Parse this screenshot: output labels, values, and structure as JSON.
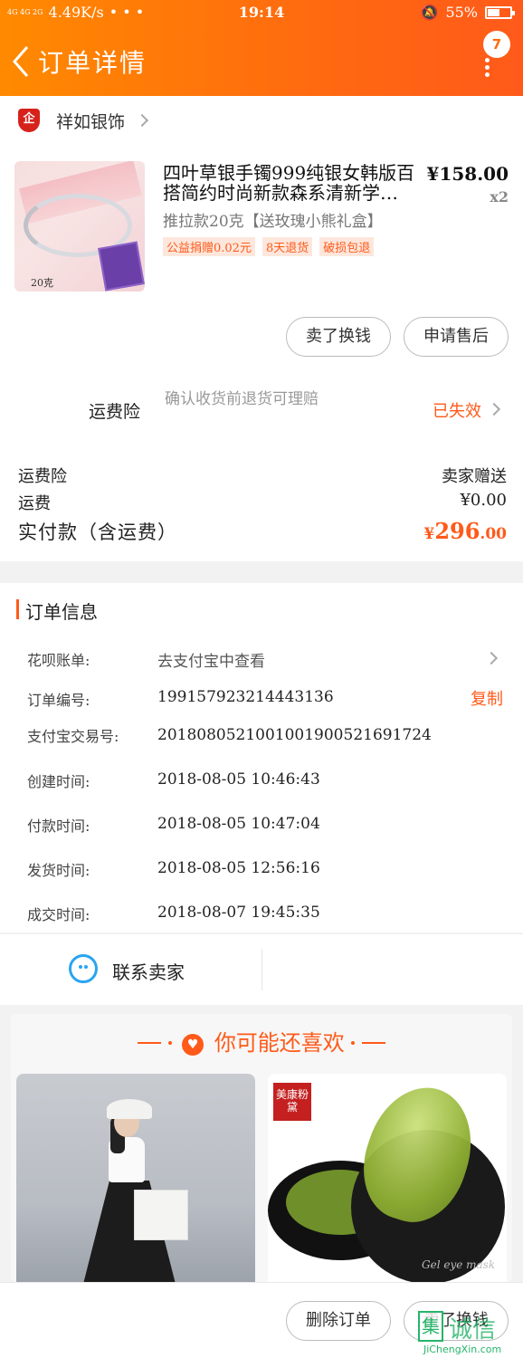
{
  "status_bar": {
    "signal": "4G 4G 2G",
    "speed": "4.49K/s",
    "dots": "• • •",
    "time": "19:14",
    "battery": "55%",
    "battery_level": 0.55
  },
  "nav": {
    "title": "订单详情",
    "badge_count": "7"
  },
  "store": {
    "logo_text": "企",
    "name": "祥如银饰"
  },
  "product": {
    "image_caption": "20克",
    "title": "四叶草银手镯999纯银女韩版百搭简约时尚新款森系清新学…",
    "price": "¥158.00",
    "quantity": "x2",
    "sku": "推拉款20克【送玫瑰小熊礼盒】",
    "tags": [
      "公益捐赠0.02元",
      "8天退货",
      "破损包退"
    ]
  },
  "actions": {
    "sell_label": "卖了换钱",
    "aftersale_label": "申请售后"
  },
  "insurance": {
    "label": "运费险",
    "description": "确认收货前退货可理赔",
    "status": "已失效"
  },
  "fees": [
    {
      "label": "运费险",
      "value": "卖家赠送"
    },
    {
      "label": "运费",
      "value": "¥0.00"
    }
  ],
  "total": {
    "label": "实付款（含运费）",
    "currency": "¥",
    "integer": "296",
    "decimal": ".00"
  },
  "order_info": {
    "section_title": "订单信息",
    "rows": [
      {
        "label": "花呗账单:",
        "value": "去支付宝中查看"
      },
      {
        "label": "订单编号:",
        "value": "199157923214443136"
      },
      {
        "label": "支付宝交易号:",
        "value": "2018080521001001900521691724"
      },
      {
        "label": "创建时间:",
        "value": "2018-08-05  10:46:43"
      },
      {
        "label": "付款时间:",
        "value": "2018-08-05  10:47:04"
      },
      {
        "label": "发货时间:",
        "value": "2018-08-05  12:56:16"
      },
      {
        "label": "成交时间:",
        "value": "2018-08-07  19:45:35"
      }
    ],
    "copy_label": "复制"
  },
  "contact": {
    "label": "联系卖家"
  },
  "recommend": {
    "title": "你可能还喜欢",
    "heart": "♥",
    "brand_stamp": "美康粉黛",
    "jar_text": "Gel eye mask"
  },
  "bottom": {
    "delete_label": "删除订单",
    "sell_label": "卖了换钱"
  },
  "watermark": {
    "box": "集",
    "text": "诚信",
    "url": "JiChengXin.com"
  }
}
